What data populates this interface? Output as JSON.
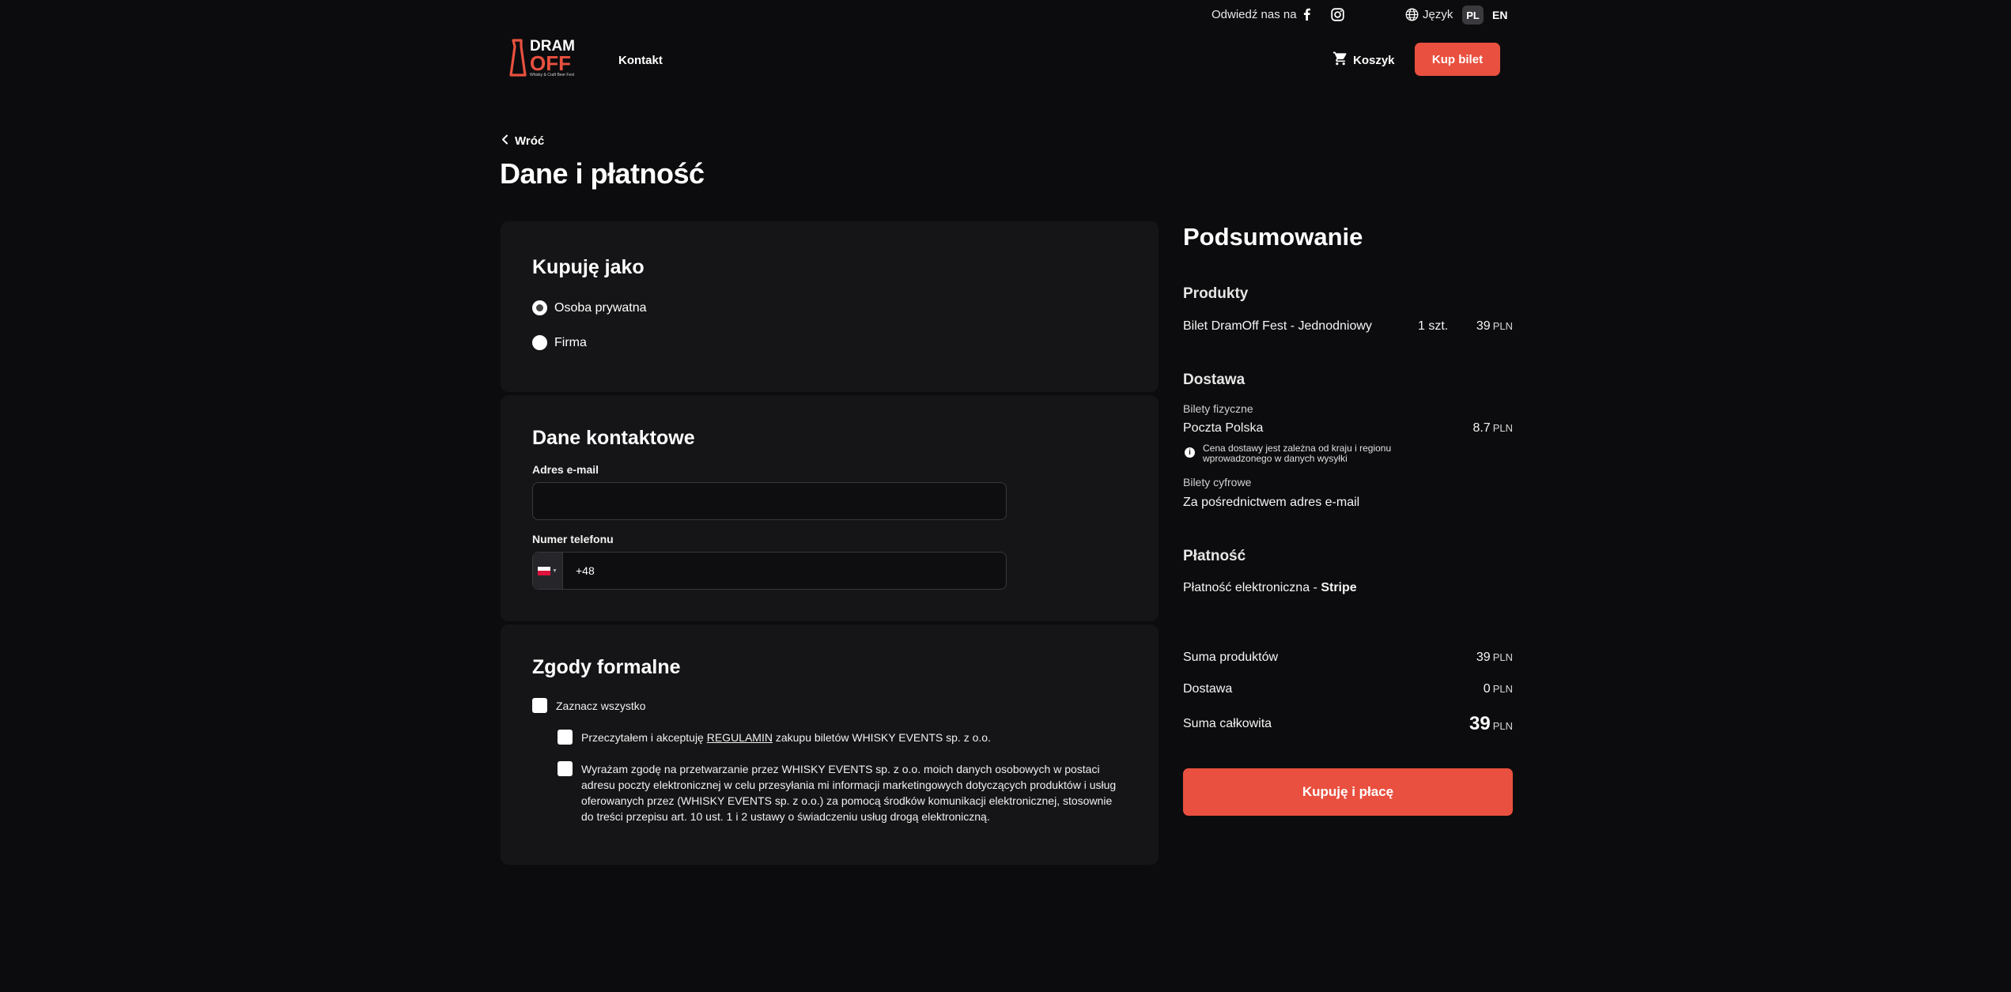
{
  "topbar": {
    "visit_text": "Odwiedź nas na",
    "language_label": "Język",
    "lang_pl": "PL",
    "lang_en": "EN"
  },
  "header": {
    "logo_line1": "DRAM",
    "logo_line2": "OFF",
    "logo_sub": "Whisky & Craft Beer Fest",
    "nav_contact": "Kontakt",
    "cart_label": "Koszyk",
    "buy_ticket": "Kup bilet"
  },
  "page": {
    "back": "Wróć",
    "title": "Dane i płatność"
  },
  "buyer": {
    "heading": "Kupuję jako",
    "options": [
      {
        "label": "Osoba prywatna",
        "checked": true
      },
      {
        "label": "Firma",
        "checked": false
      }
    ]
  },
  "contact": {
    "heading": "Dane kontaktowe",
    "email_label": "Adres e-mail",
    "email_value": "",
    "phone_label": "Numer telefonu",
    "phone_value": "+48"
  },
  "consents": {
    "heading": "Zgody formalne",
    "select_all": "Zaznacz wszystko",
    "terms_before": "Przeczytałem i akceptuję ",
    "terms_link": "REGULAMIN",
    "terms_after": " zakupu biletów WHISKY EVENTS sp. z o.o.",
    "marketing": "Wyrażam zgodę na przetwarzanie przez WHISKY EVENTS sp. z o.o. moich danych osobowych w postaci adresu poczty elektronicznej w celu przesyłania mi informacji marketingowych dotyczących produktów i usług oferowanych przez (WHISKY EVENTS sp. z o.o.) za pomocą środków komunikacji elektronicznej, stosownie do treści przepisu art. 10 ust. 1 i 2 ustawy o świadczeniu usług drogą elektroniczną."
  },
  "summary": {
    "title": "Podsumowanie",
    "products_heading": "Produkty",
    "product_name": "Bilet DramOff Fest - Jednodniowy",
    "product_qty": "1 szt.",
    "product_price": "39",
    "currency": "PLN",
    "delivery_heading": "Dostawa",
    "physical_label": "Bilety fizyczne",
    "physical_method": "Poczta Polska",
    "physical_price": "8.7",
    "delivery_note": "Cena dostawy jest zależna od kraju i regionu wprowadzonego w danych wysyłki",
    "digital_label": "Bilety cyfrowe",
    "digital_method": "Za pośrednictwem adres e-mail",
    "payment_heading": "Płatność",
    "payment_method": "Płatność elektroniczna - ",
    "payment_provider": "Stripe",
    "products_sum_label": "Suma produktów",
    "products_sum": "39",
    "delivery_sum_label": "Dostawa",
    "delivery_sum": "0",
    "total_label": "Suma całkowita",
    "total": "39",
    "pay_button": "Kupuję i płacę"
  },
  "colors": {
    "accent": "#e9503f",
    "background": "#0c0c0e",
    "panel": "#151517"
  }
}
